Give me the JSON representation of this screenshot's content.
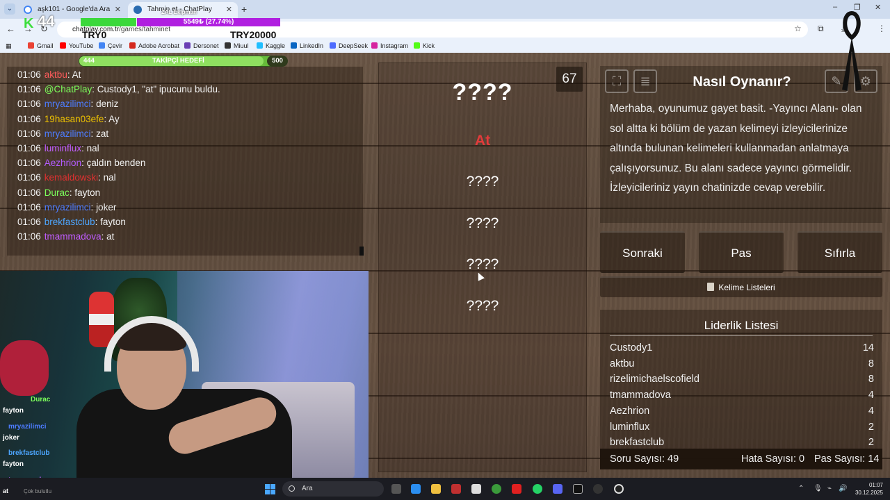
{
  "browser": {
    "tabs": [
      {
        "title": "aşk101 - Google'da Ara",
        "color": "#4285f4"
      },
      {
        "title": "Tahmin et - ChatPlay",
        "color": "#2b6cb0"
      }
    ],
    "new_tab": "+",
    "window_controls": [
      "–",
      "❐",
      "✕"
    ],
    "url_domain": "chatplay.com.tr",
    "url_path": "/games/tahminet",
    "bookmarks": [
      "Gmail",
      "YouTube",
      "Çevir",
      "Adobe Acrobat",
      "Dersonet",
      "Miuul",
      "Kaggle",
      "LinkedIn",
      "DeepSeek",
      "Instagram",
      "Kick"
    ]
  },
  "overlay": {
    "logo": "K",
    "count": "44",
    "currency_current": "TRY0",
    "progress_label": "5549₺ (27.74%)",
    "progress_fraction": 0.2774,
    "top_label": "ZAL Ekipman",
    "currency_goal": "TRY20000",
    "follower_goal": {
      "current": "444",
      "label": "TAKİPÇİ HEDEFİ",
      "target": "500",
      "fraction": 0.888
    }
  },
  "chat": [
    {
      "time": "01:06",
      "user": "aktbu",
      "color": "#ff5c5c",
      "msg": "At"
    },
    {
      "time": "01:06",
      "user": "@ChatPlay",
      "color": "#7cff5c",
      "msg": "Custody1, \"at\" ipucunu buldu."
    },
    {
      "time": "01:06",
      "user": "mryazilimci",
      "color": "#4d7cff",
      "msg": "deniz"
    },
    {
      "time": "01:06",
      "user": "19hasan03efe",
      "color": "#f0c400",
      "msg": "Ay"
    },
    {
      "time": "01:06",
      "user": "mryazilimci",
      "color": "#4d7cff",
      "msg": "zat"
    },
    {
      "time": "01:06",
      "user": "luminflux",
      "color": "#c05cff",
      "msg": "nal"
    },
    {
      "time": "01:06",
      "user": "Aezhrion",
      "color": "#b35cff",
      "msg": "çaldın benden"
    },
    {
      "time": "01:06",
      "user": "kemaldowski",
      "color": "#e03030",
      "msg": "nal"
    },
    {
      "time": "01:06",
      "user": "Durac",
      "color": "#7cff5c",
      "msg": "fayton"
    },
    {
      "time": "01:06",
      "user": "mryazilimci",
      "color": "#4d7cff",
      "msg": "joker"
    },
    {
      "time": "01:06",
      "user": "brekfastclub",
      "color": "#4da6ff",
      "msg": "fayton"
    },
    {
      "time": "01:06",
      "user": "tmammadova",
      "color": "#c05cff",
      "msg": "at"
    }
  ],
  "game": {
    "timer": "67",
    "main_word": "????",
    "revealed_hint": "At",
    "taboo_words": [
      "????",
      "????",
      "????",
      "????"
    ]
  },
  "howto": {
    "title": "Nasıl Oynanır?",
    "text": "Merhaba, oyunumuz gayet basit. -Yayıncı Alanı- olan sol altta ki bölüm de yazan kelimeyi izleyicilerinize altında bulunan kelimeleri kullanmadan anlatmaya çalışıyorsunuz. Bu alanı sadece yayıncı görmelidir. İzleyicileriniz yayın chatinizde cevap verebilir."
  },
  "controls": {
    "next": "Sonraki",
    "pass": "Pas",
    "reset": "Sıfırla",
    "word_lists": "Kelime Listeleri"
  },
  "leaderboard": {
    "title": "Liderlik Listesi",
    "rows": [
      {
        "name": "Custody1",
        "score": "14"
      },
      {
        "name": "aktbu",
        "score": "8"
      },
      {
        "name": "rizelimichaelscofield",
        "score": "8"
      },
      {
        "name": "tmammadova",
        "score": "4"
      },
      {
        "name": "Aezhrion",
        "score": "4"
      },
      {
        "name": "luminflux",
        "score": "2"
      },
      {
        "name": "brekfastclub",
        "score": "2"
      }
    ],
    "question_count": "Soru Sayısı: 49",
    "error_count": "Hata Sayısı: 0",
    "pass_count": "Pas Sayısı: 14"
  },
  "stream_chat": [
    {
      "user": "Durac",
      "color": "#7cff5c",
      "msg": "fayton"
    },
    {
      "user": "mryazilimci",
      "color": "#4d7cff",
      "msg": "joker"
    },
    {
      "user": "brekfastclub",
      "color": "#4da6ff",
      "msg": "fayton"
    },
    {
      "user": "tmammadova",
      "color": "#c05cff",
      "msg": "at"
    }
  ],
  "taskbar": {
    "search_placeholder": "Ara",
    "status": "Çok bulutlu",
    "time": "01:07",
    "date": "30.12.2025"
  }
}
